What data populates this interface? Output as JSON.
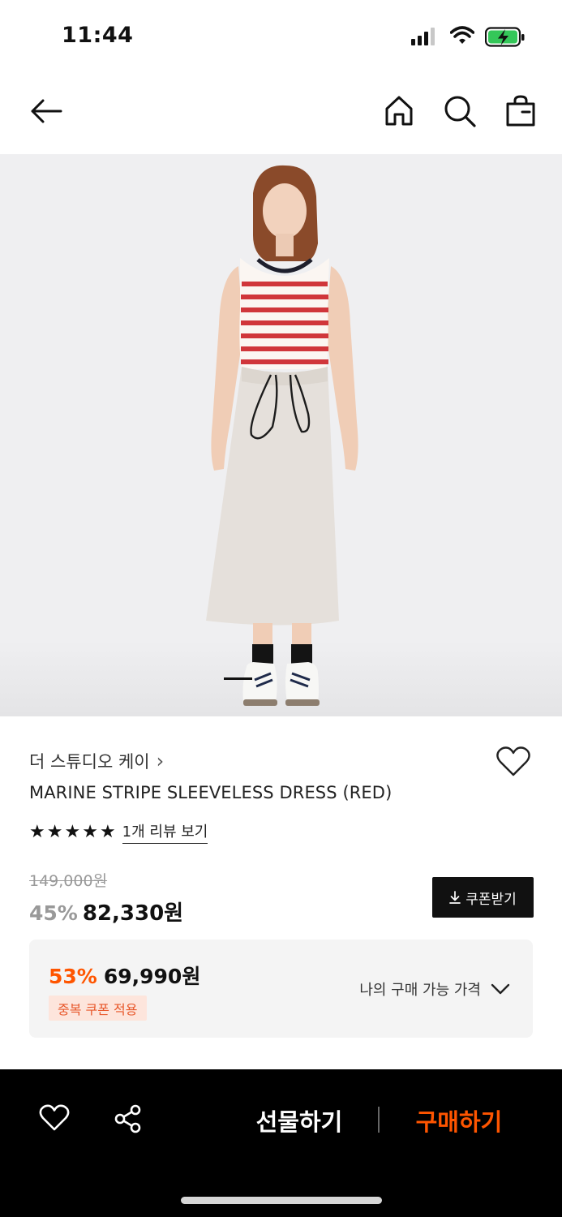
{
  "status_bar": {
    "time": "11:44"
  },
  "nav": {
    "back_icon": "arrow-left-icon",
    "home_icon": "home-icon",
    "search_icon": "search-icon",
    "bag_icon": "shopping-bag-icon"
  },
  "gallery": {
    "image_description": "product photo",
    "current_index": 1
  },
  "product": {
    "brand": "더 스튜디오 케이",
    "brand_chevron": "›",
    "name": "MARINE STRIPE SLEEVELESS DRESS (RED)",
    "rating_stars": 5,
    "review_link": "1개 리뷰 보기",
    "original_price": "149,000원",
    "discount": "45%",
    "sale_price": "82,330원",
    "coupon_button": "쿠폰받기"
  },
  "best_price": {
    "discount": "53%",
    "price": "69,990원",
    "badge": "중복 쿠폰 적용",
    "my_price_label": "나의 구매 가능 가격"
  },
  "bottom_bar": {
    "gift_label": "선물하기",
    "buy_label": "구매하기"
  },
  "colors": {
    "accent": "#ff5500",
    "badge_bg": "#fde5dc",
    "bottom_bar_bg": "#000000"
  }
}
